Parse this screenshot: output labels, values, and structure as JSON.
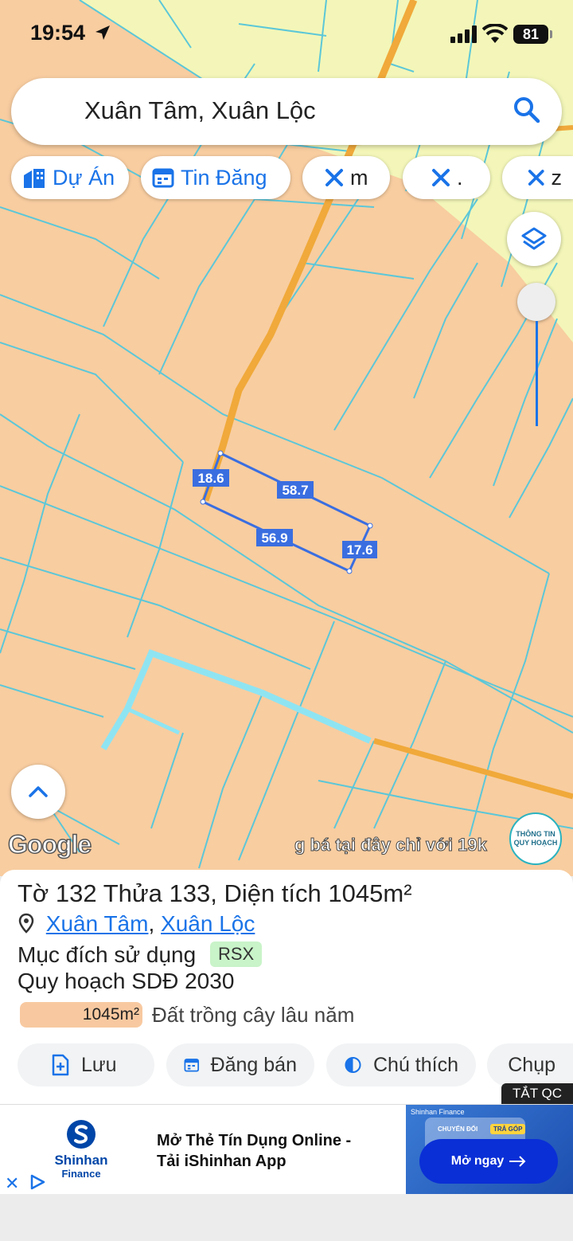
{
  "status_bar": {
    "time": "19:54",
    "battery": "81"
  },
  "search": {
    "query": "Xuân Tâm, Xuân Lộc"
  },
  "filter_chips": [
    {
      "label": "Dự Án",
      "icon": "city-icon"
    },
    {
      "label": "Tin Đăng",
      "icon": "calendar-icon"
    },
    {
      "label": "m",
      "icon": "ruler-icon"
    },
    {
      "label": ".",
      "icon": "ruler-icon"
    },
    {
      "label": "z",
      "icon": "ruler-icon"
    }
  ],
  "map": {
    "colors": {
      "land": "#f8cda0",
      "parcel_line": "#5cc7d8",
      "zone_yellow": "#f3f6b8",
      "road": "#f0a93a",
      "canal": "#8fe4f2",
      "measure": "#3a6ee0"
    },
    "measurements": [
      {
        "label": "18.6"
      },
      {
        "label": "58.7"
      },
      {
        "label": "56.9"
      },
      {
        "label": "17.6"
      }
    ],
    "attribution": "Google",
    "ticker": "g bá tại đây chỉ với 19k",
    "badge": "THÔNG TIN QUY HOẠCH"
  },
  "parcel": {
    "sheet_label": "Tờ",
    "sheet": "132",
    "plot_label": "Thửa",
    "plot": "133",
    "area_label": "Diện tích",
    "area": "1045",
    "area_unit": "m²",
    "commune": "Xuân Tâm",
    "district": "Xuân Lộc",
    "usage_label": "Mục đích sử dụng",
    "usage_code": "RSX",
    "plan_label": "Quy hoạch SDĐ 2030",
    "plan_area": "1045m²",
    "plan_desc": "Đất trồng cây lâu năm",
    "plan_color": "#f8c9a0"
  },
  "actions": [
    {
      "label": "Lưu",
      "icon": "add-file-icon"
    },
    {
      "label": "Đăng bán",
      "icon": "calendar-icon"
    },
    {
      "label": "Chú thích",
      "icon": "contrast-icon"
    },
    {
      "label": "Chụp",
      "icon": "camera-plus-icon"
    }
  ],
  "ad": {
    "hide_label": "TẮT QC",
    "brand": "Shinhan",
    "brand_sub": "Finance",
    "title_line1": "Mở Thẻ Tín Dụng Online -",
    "title_line2": "Tải iShinhan App",
    "image_brand": "Shinhan Finance",
    "image_card_text": "CHUYỂN ĐỔI",
    "image_card_button": "TRẢ GÓP",
    "cta": "Mở ngay"
  }
}
